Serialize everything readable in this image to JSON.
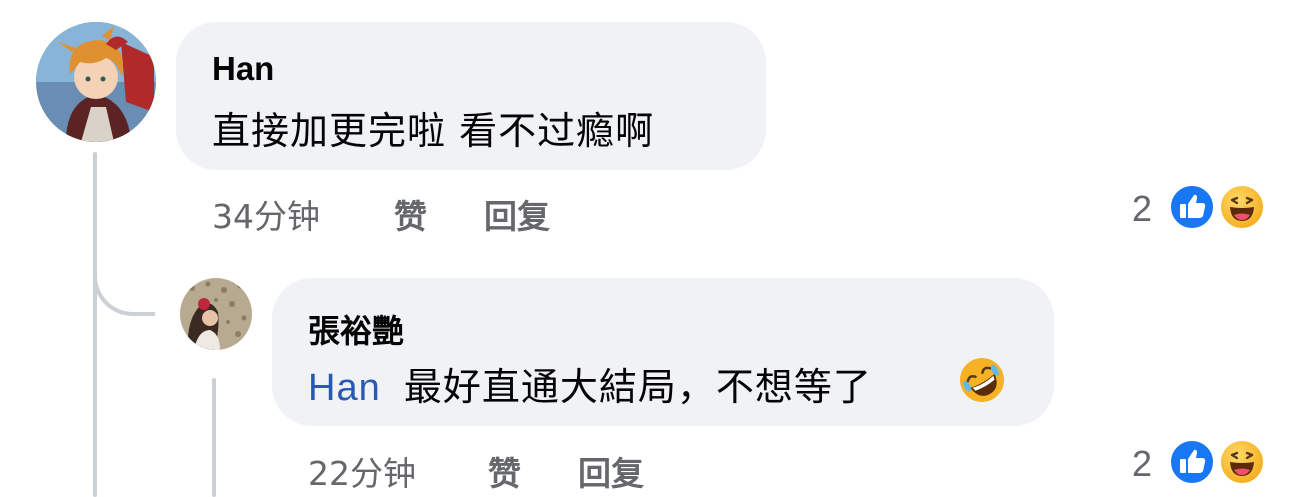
{
  "comments": [
    {
      "author": "Han",
      "text": "直接加更完啦 看不过瘾啊",
      "time": "34分钟",
      "like_label": "赞",
      "reply_label": "回复",
      "reaction_count": "2",
      "reactions": [
        "like-icon",
        "haha-icon"
      ]
    }
  ],
  "replies": [
    {
      "author": "張裕艷",
      "mention": "Han",
      "text": "最好直通大結局，不想等了",
      "emoji": "rolling-on-floor-laughing-emoji",
      "time": "22分钟",
      "like_label": "赞",
      "reply_label": "回复",
      "reaction_count": "2",
      "reactions": [
        "like-icon",
        "haha-icon"
      ]
    }
  ],
  "colors": {
    "bubble": "#f0f2f5",
    "text": "#050505",
    "meta": "#65676b",
    "mention": "#2a59b3",
    "like": "#1877f2",
    "thread_line": "#ccd0d5"
  }
}
